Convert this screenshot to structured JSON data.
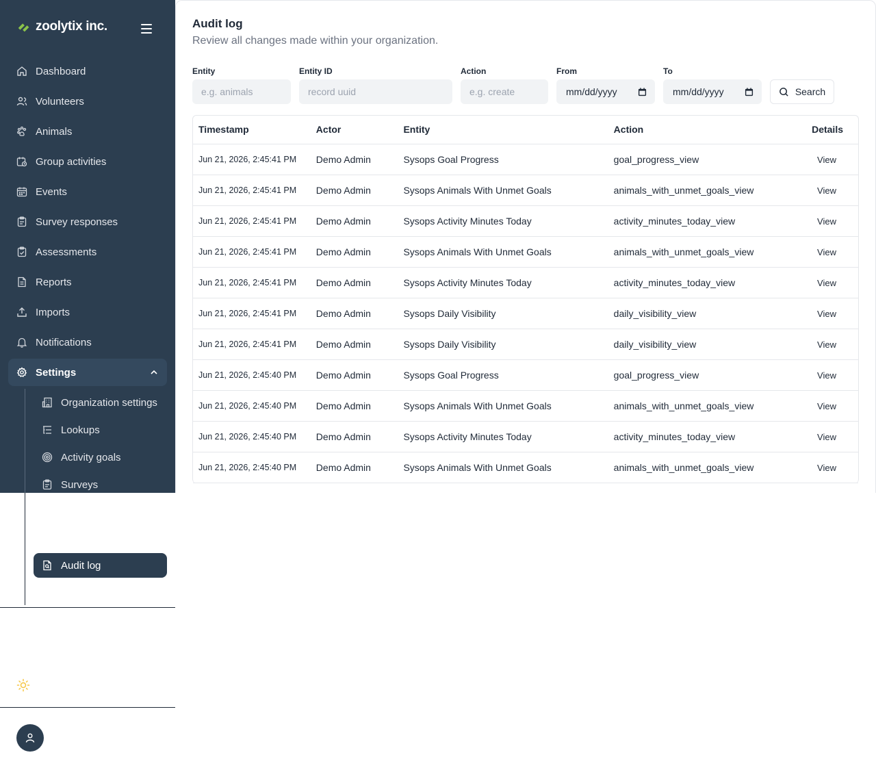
{
  "brand": {
    "name": "zoolytix inc.",
    "accent": "#8bc34a"
  },
  "sidebar": {
    "items": [
      {
        "label": "Dashboard",
        "icon": "home-icon"
      },
      {
        "label": "Volunteers",
        "icon": "users-icon"
      },
      {
        "label": "Animals",
        "icon": "paw-icon"
      },
      {
        "label": "Group activities",
        "icon": "calendar-clock-icon"
      },
      {
        "label": "Events",
        "icon": "calendar-icon"
      },
      {
        "label": "Survey responses",
        "icon": "clipboard-icon"
      },
      {
        "label": "Assessments",
        "icon": "clipboard-check-icon"
      },
      {
        "label": "Reports",
        "icon": "file-text-icon"
      },
      {
        "label": "Imports",
        "icon": "upload-icon"
      },
      {
        "label": "Notifications",
        "icon": "bell-icon"
      }
    ],
    "settings": {
      "label": "Settings",
      "icon": "gear-icon",
      "expanded": true
    },
    "sub_items": [
      {
        "label": "Organization settings",
        "icon": "building-icon"
      },
      {
        "label": "Lookups",
        "icon": "list-tree-icon"
      },
      {
        "label": "Activity goals",
        "icon": "target-icon"
      },
      {
        "label": "Surveys",
        "icon": "clipboard-icon"
      }
    ],
    "audit_item": {
      "label": "Audit log",
      "icon": "file-search-icon"
    }
  },
  "page": {
    "title": "Audit log",
    "subtitle": "Review all changes made within your organization."
  },
  "filters": {
    "entity": {
      "label": "Entity",
      "placeholder": "e.g. animals"
    },
    "entity_id": {
      "label": "Entity ID",
      "placeholder": "record uuid"
    },
    "action": {
      "label": "Action",
      "placeholder": "e.g. create"
    },
    "from": {
      "label": "From",
      "value": "mm/dd/yyyy"
    },
    "to": {
      "label": "To",
      "value": "mm/dd/yyyy"
    },
    "search_label": "Search"
  },
  "table": {
    "headers": {
      "timestamp": "Timestamp",
      "actor": "Actor",
      "entity": "Entity",
      "action": "Action",
      "details": "Details"
    },
    "view_label": "View",
    "rows": [
      {
        "timestamp": "Jun 21, 2026, 2:45:41 PM",
        "actor": "Demo Admin",
        "entity": "Sysops Goal Progress",
        "action": "goal_progress_view"
      },
      {
        "timestamp": "Jun 21, 2026, 2:45:41 PM",
        "actor": "Demo Admin",
        "entity": "Sysops Animals With Unmet Goals",
        "action": "animals_with_unmet_goals_view"
      },
      {
        "timestamp": "Jun 21, 2026, 2:45:41 PM",
        "actor": "Demo Admin",
        "entity": "Sysops Activity Minutes Today",
        "action": "activity_minutes_today_view"
      },
      {
        "timestamp": "Jun 21, 2026, 2:45:41 PM",
        "actor": "Demo Admin",
        "entity": "Sysops Animals With Unmet Goals",
        "action": "animals_with_unmet_goals_view"
      },
      {
        "timestamp": "Jun 21, 2026, 2:45:41 PM",
        "actor": "Demo Admin",
        "entity": "Sysops Activity Minutes Today",
        "action": "activity_minutes_today_view"
      },
      {
        "timestamp": "Jun 21, 2026, 2:45:41 PM",
        "actor": "Demo Admin",
        "entity": "Sysops Daily Visibility",
        "action": "daily_visibility_view"
      },
      {
        "timestamp": "Jun 21, 2026, 2:45:41 PM",
        "actor": "Demo Admin",
        "entity": "Sysops Daily Visibility",
        "action": "daily_visibility_view"
      },
      {
        "timestamp": "Jun 21, 2026, 2:45:40 PM",
        "actor": "Demo Admin",
        "entity": "Sysops Goal Progress",
        "action": "goal_progress_view"
      },
      {
        "timestamp": "Jun 21, 2026, 2:45:40 PM",
        "actor": "Demo Admin",
        "entity": "Sysops Animals With Unmet Goals",
        "action": "animals_with_unmet_goals_view"
      },
      {
        "timestamp": "Jun 21, 2026, 2:45:40 PM",
        "actor": "Demo Admin",
        "entity": "Sysops Activity Minutes Today",
        "action": "activity_minutes_today_view"
      },
      {
        "timestamp": "Jun 21, 2026, 2:45:40 PM",
        "actor": "Demo Admin",
        "entity": "Sysops Animals With Unmet Goals",
        "action": "animals_with_unmet_goals_view"
      }
    ]
  },
  "colors": {
    "sidebar_bg": "#2c3e50",
    "accent_green": "#8bc34a",
    "theme_icon": "#f5c542"
  }
}
